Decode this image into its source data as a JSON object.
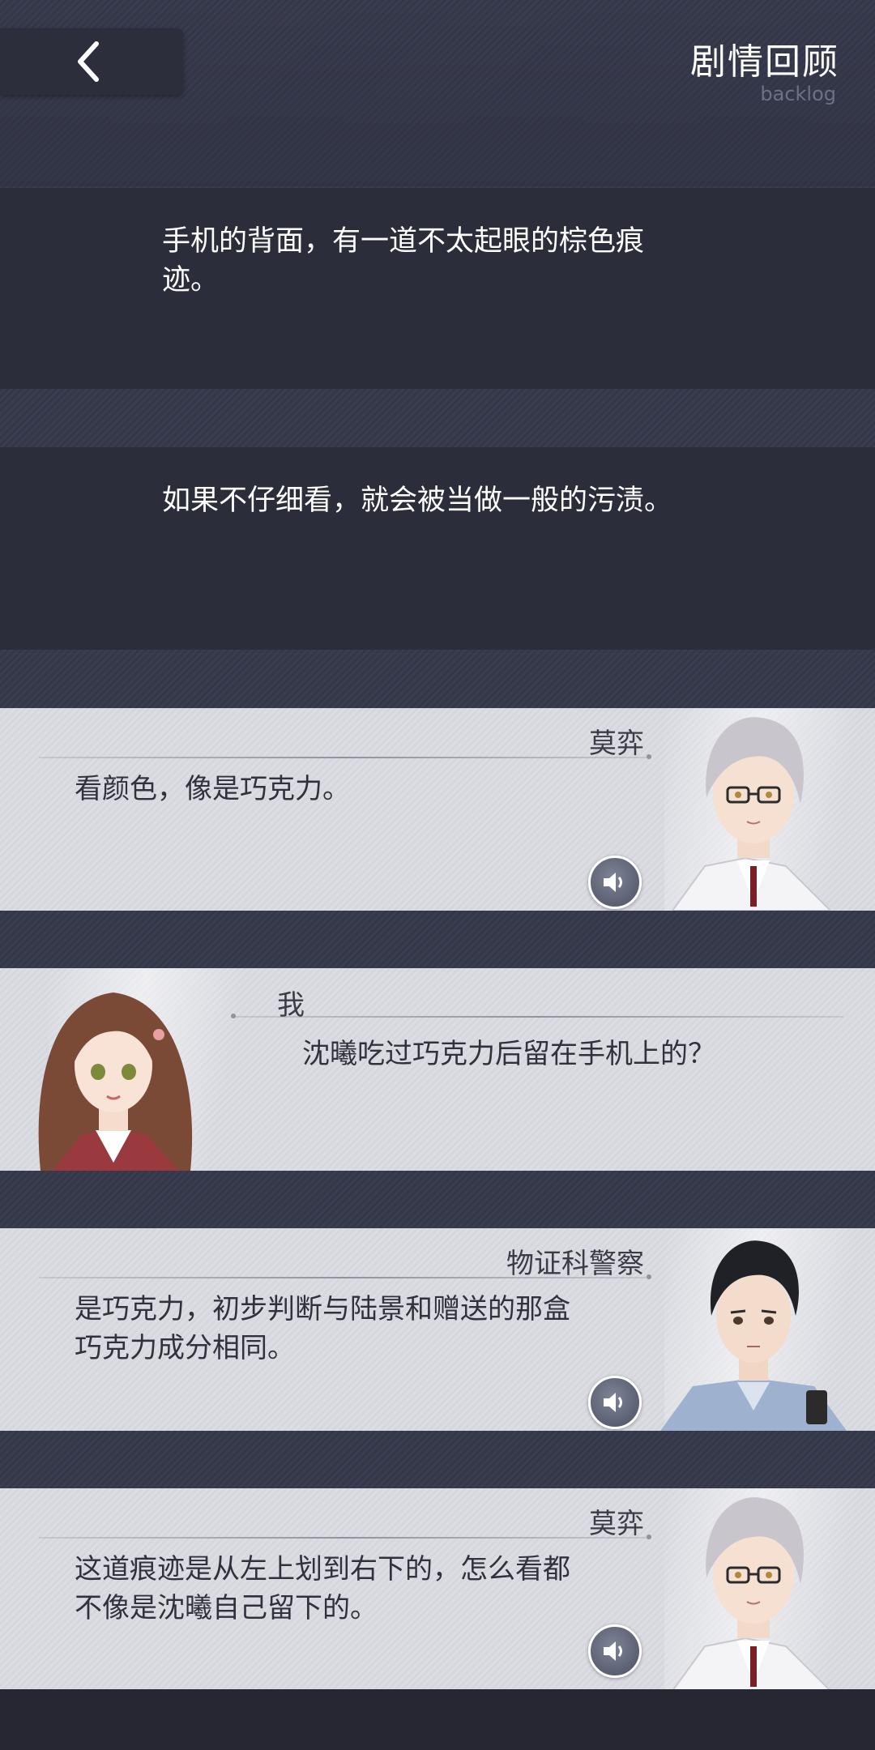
{
  "header": {
    "back_icon": "chevron-left-icon",
    "title": "剧情回顾",
    "subtitle": "backlog"
  },
  "log": [
    {
      "type": "narration",
      "lines": [
        "手机的背面，有一道不太起眼的棕色痕",
        "迹。"
      ]
    },
    {
      "type": "narration",
      "lines": [
        "如果不仔细看，就会被当做一般的污渍。"
      ]
    },
    {
      "type": "dialogue",
      "speaker": "莫弈",
      "side": "right",
      "lines": [
        "看颜色，像是巧克力。"
      ],
      "voice_icon": "speaker-icon"
    },
    {
      "type": "dialogue",
      "speaker": "我",
      "side": "left",
      "lines": [
        "沈曦吃过巧克力后留在手机上的？"
      ]
    },
    {
      "type": "dialogue",
      "speaker": "物证科警察",
      "side": "right",
      "lines": [
        "是巧克力，初步判断与陆景和赠送的那盒",
        "巧克力成分相同。"
      ],
      "voice_icon": "speaker-icon"
    },
    {
      "type": "dialogue",
      "speaker": "莫弈",
      "side": "right",
      "lines": [
        "这道痕迹是从左上划到右下的，怎么看都",
        "不像是沈曦自己留下的。"
      ],
      "voice_icon": "speaker-icon"
    }
  ],
  "colors": {
    "panel_dark": "#2c2d3b",
    "card_light": "#dcdde3",
    "text_light": "#ffffff",
    "text_dark": "#2f313c"
  }
}
